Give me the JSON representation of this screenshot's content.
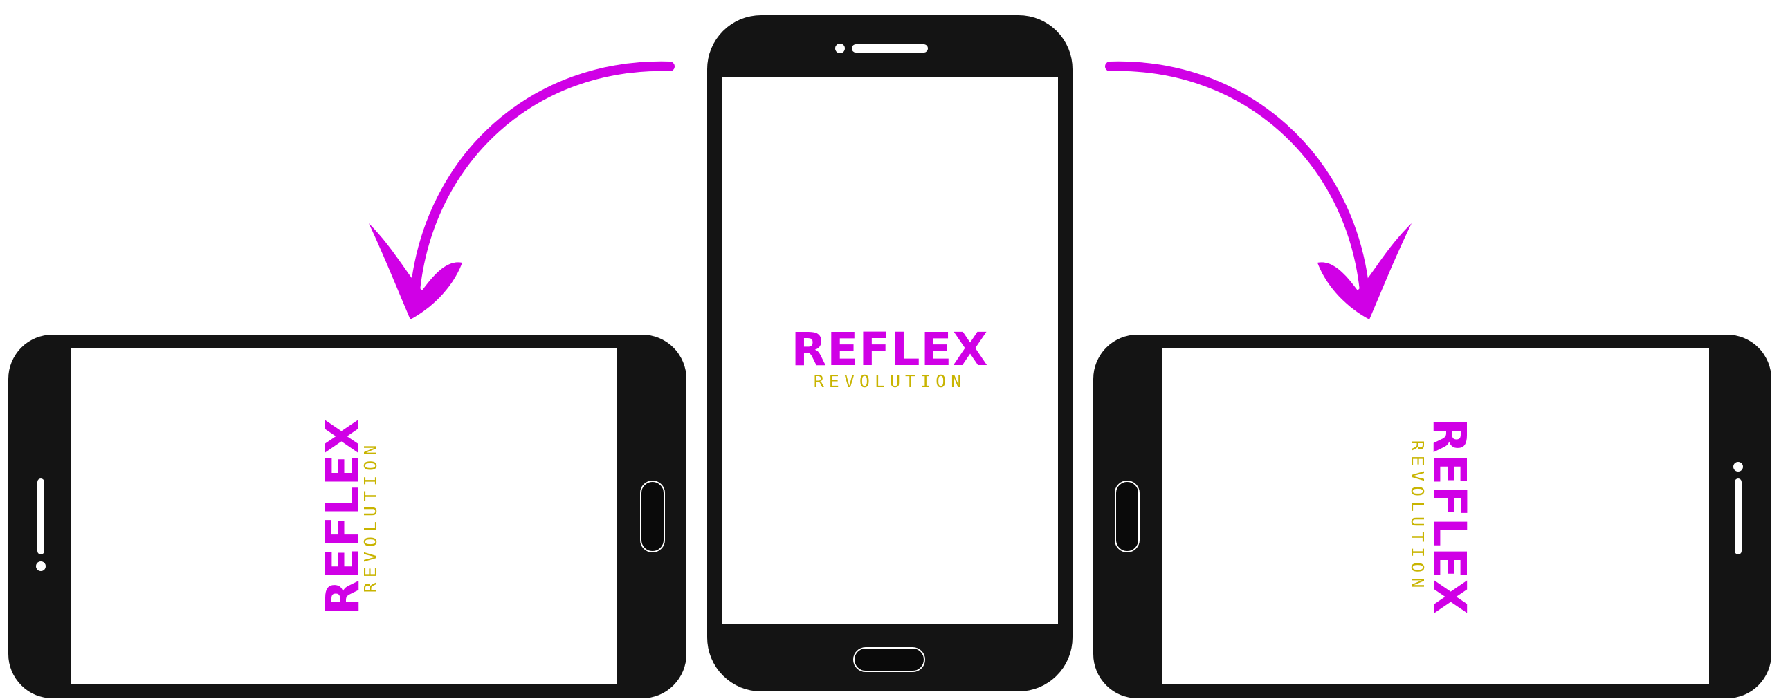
{
  "logo": {
    "title": "REFLEX",
    "subtitle": "REVOLUTION"
  },
  "colors": {
    "phone_body": "#141414",
    "screen": "#ffffff",
    "accent_magenta": "#d000e6",
    "accent_gold": "#c8b400"
  },
  "orientations": [
    "landscape-left",
    "portrait",
    "landscape-right"
  ]
}
